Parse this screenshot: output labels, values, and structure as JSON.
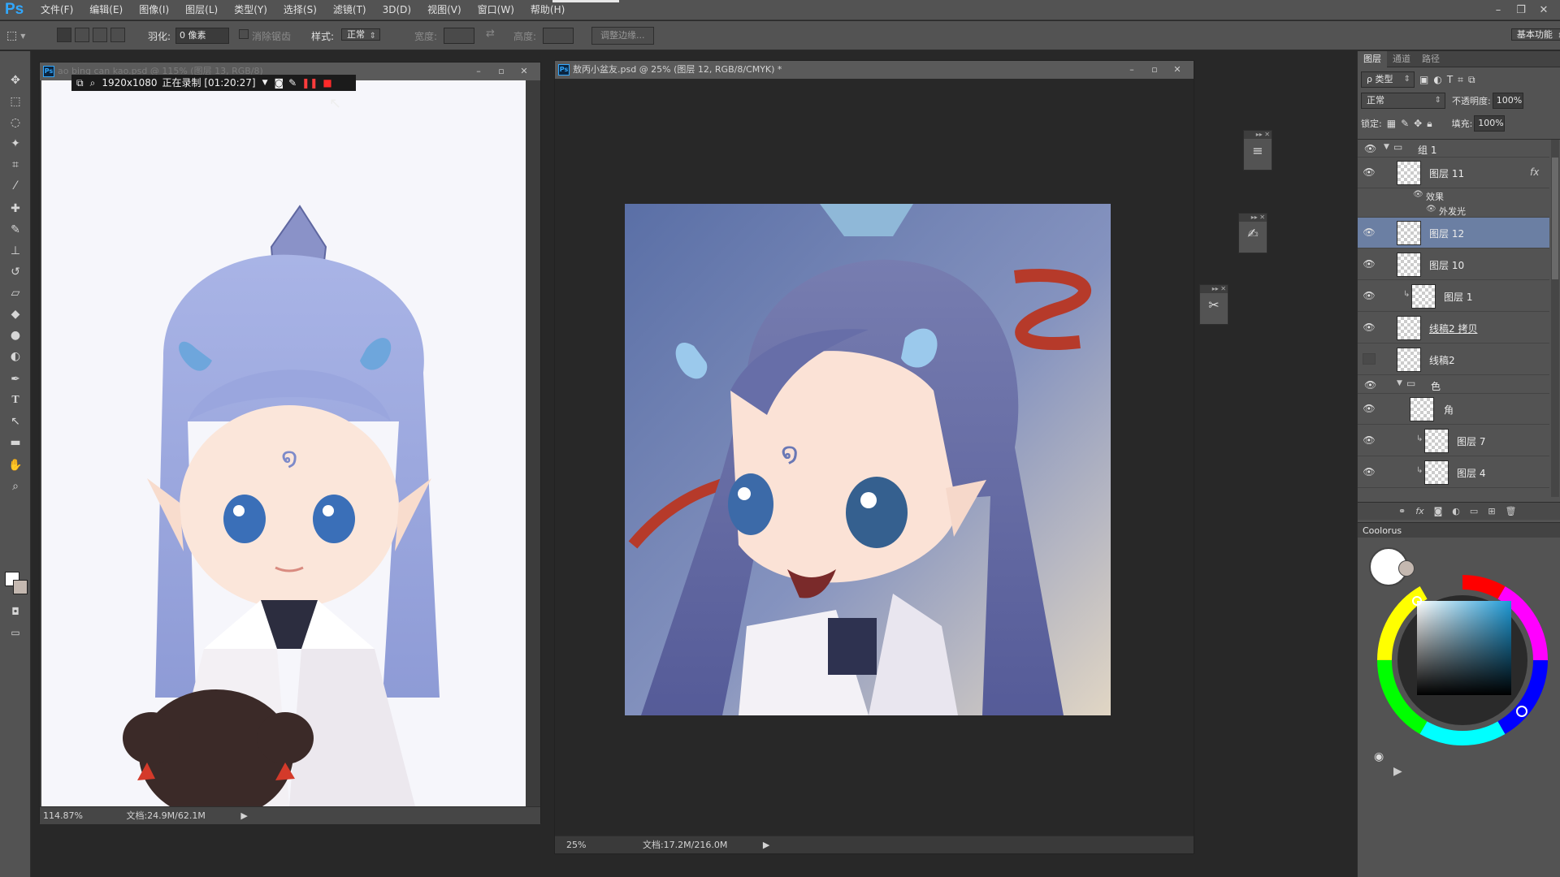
{
  "app": {
    "logo": "Ps",
    "top_right_workspace": "基本功能"
  },
  "menubar": {
    "items": [
      "文件(F)",
      "编辑(E)",
      "图像(I)",
      "图层(L)",
      "类型(Y)",
      "选择(S)",
      "滤镜(T)",
      "3D(D)",
      "视图(V)",
      "窗口(W)",
      "帮助(H)"
    ],
    "window_controls": [
      "–",
      "❐",
      "✕"
    ]
  },
  "options": {
    "feather_label": "羽化:",
    "feather_value": "0 像素",
    "antialias_label": "消除锯齿",
    "style_label": "样式:",
    "style_value": "正常",
    "width_label": "宽度:",
    "height_label": "高度:",
    "refine_button": "调整边缘..."
  },
  "toolbox": {
    "icons": [
      "move-icon",
      "marquee-icon",
      "lasso-icon",
      "magic-wand-icon",
      "crop-icon",
      "eyedropper-icon",
      "healing-brush-icon",
      "brush-icon",
      "clone-stamp-icon",
      "history-brush-icon",
      "eraser-icon",
      "paint-bucket-icon",
      "blur-icon",
      "dodge-icon",
      "pen-icon",
      "type-icon",
      "path-select-icon",
      "shape-icon",
      "hand-icon",
      "zoom-icon"
    ],
    "fg_color": "#ffffff",
    "bg_color": "#c4b8b0"
  },
  "doc_left": {
    "title": "ao bing can kao.psd @ 115% (图层 13, RGB/8)",
    "zoom": "114.87%",
    "doc_size": "文档:24.9M/62.1M"
  },
  "recording": {
    "resolution": "1920x1080",
    "status": "正在录制 [01:20:27]"
  },
  "doc_right": {
    "title": "敖丙小盆友.psd @ 25% (图层 12, RGB/8/CMYK) *",
    "zoom": "25%",
    "doc_size": "文档:17.2M/216.0M"
  },
  "layers_panel": {
    "tabs": [
      "图层",
      "通道",
      "路径"
    ],
    "filter_kind": "ρ 类型",
    "blend_mode": "正常",
    "opacity_label": "不透明度:",
    "opacity_value": "100%",
    "lock_label": "锁定:",
    "fill_label": "填充:",
    "fill_value": "100%",
    "group1": "组 1",
    "layer11": "图层 11",
    "fx": "fx",
    "effects_label": "效果",
    "outer_glow": "外发光",
    "layer12": "图层 12",
    "layer10": "图层 10",
    "layer1": "图层 1",
    "lineart_copy": "线稿2 拷贝",
    "lineart2": "线稿2",
    "group_color": "色",
    "horn": "角",
    "layer7": "图层 7",
    "layer4": "图层 4"
  },
  "coolorus": {
    "title": "Coolorus"
  }
}
